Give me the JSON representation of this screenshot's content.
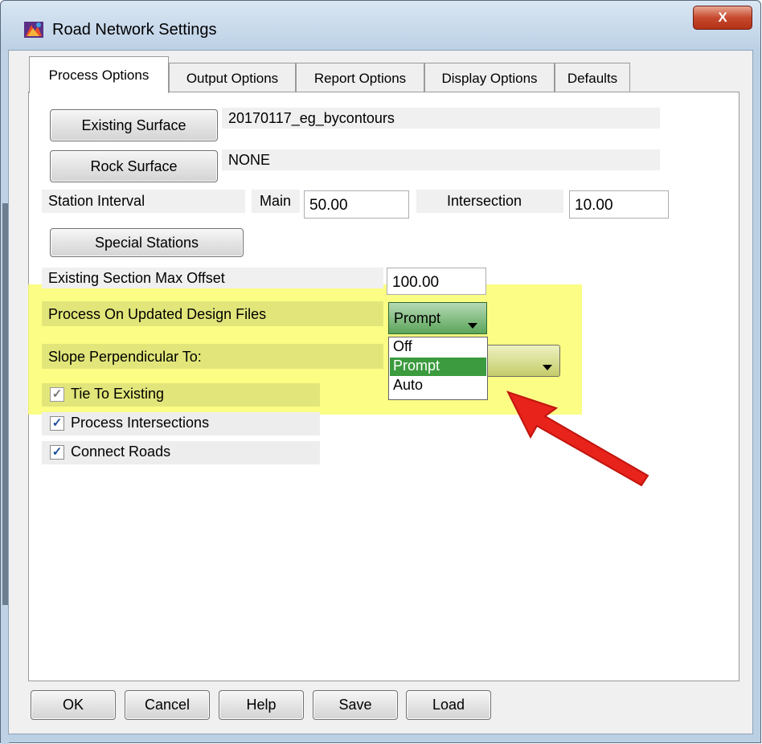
{
  "window": {
    "title": "Road Network Settings",
    "close_label": "X"
  },
  "tabs": [
    "Process Options",
    "Output Options",
    "Report Options",
    "Display Options",
    "Defaults"
  ],
  "surfaces": {
    "existing_button": "Existing Surface",
    "existing_value": "20170117_eg_bycontours",
    "rock_button": "Rock Surface",
    "rock_value": "NONE"
  },
  "station": {
    "label": "Station Interval",
    "main_label": "Main",
    "main_value": "50.00",
    "intersection_label": "Intersection",
    "intersection_value": "10.00"
  },
  "special_stations_button": "Special Stations",
  "max_offset": {
    "label": "Existing Section Max Offset",
    "value": "100.00"
  },
  "process_updated": {
    "label": "Process On Updated Design Files",
    "selected": "Prompt",
    "options": [
      "Off",
      "Prompt",
      "Auto"
    ]
  },
  "slope": {
    "label": "Slope Perpendicular To:"
  },
  "checkboxes": [
    {
      "label": "Tie To Existing",
      "checked": true
    },
    {
      "label": "Process Intersections",
      "checked": true
    },
    {
      "label": "Connect Roads",
      "checked": true
    }
  ],
  "buttons": [
    "OK",
    "Cancel",
    "Help",
    "Save",
    "Load"
  ],
  "colors": {
    "highlight": "#fafd6e",
    "annotation_arrow": "#e8231c",
    "combo_green": "#5ba55a"
  }
}
